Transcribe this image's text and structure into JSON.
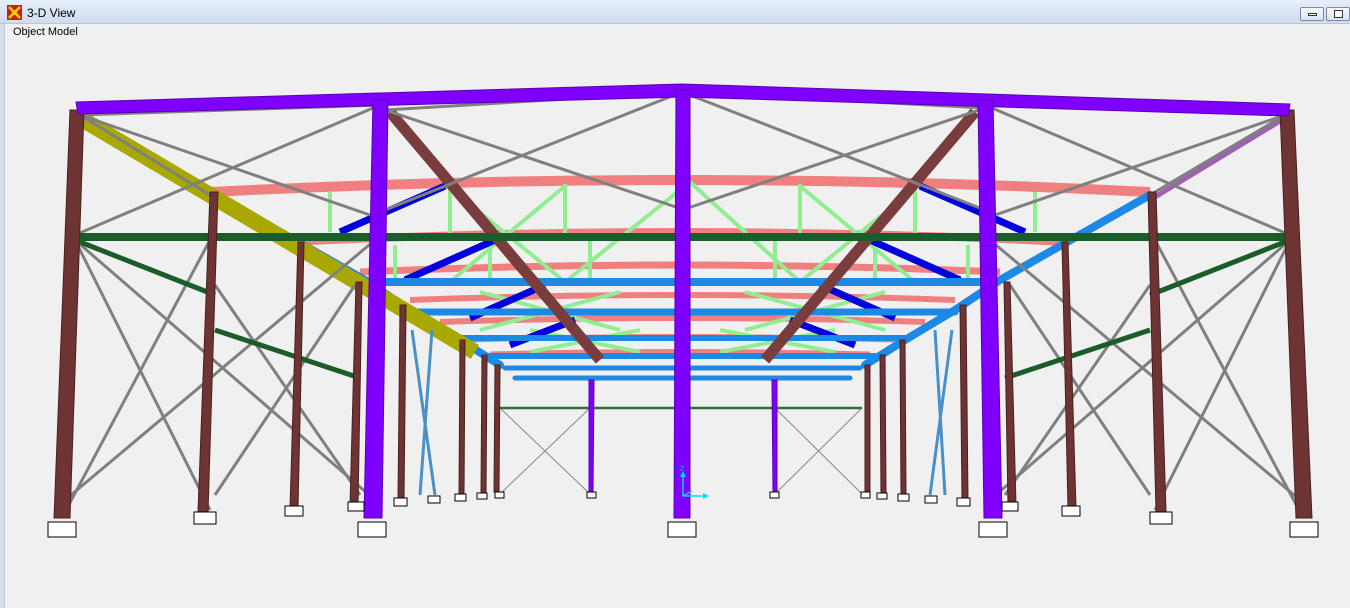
{
  "window": {
    "title": "3-D View",
    "minimize_icon": "minimize-icon",
    "restore_icon": "restore-icon",
    "app_icon": "sap-app-icon"
  },
  "view": {
    "label": "Object Model"
  },
  "axis": {
    "z_label": "Z",
    "color": "#00d8ff"
  },
  "colors": {
    "column": "#6e3434",
    "portal": "#8000ff",
    "bracing": "#808080",
    "roof_purlin": "#f08080",
    "roof_rafter": "#1e88e5",
    "roof_diag": "#0000dd",
    "truss_web": "#90ee90",
    "girt_dark": "#1a5c2a",
    "yellow_brace": "#a8a800"
  }
}
